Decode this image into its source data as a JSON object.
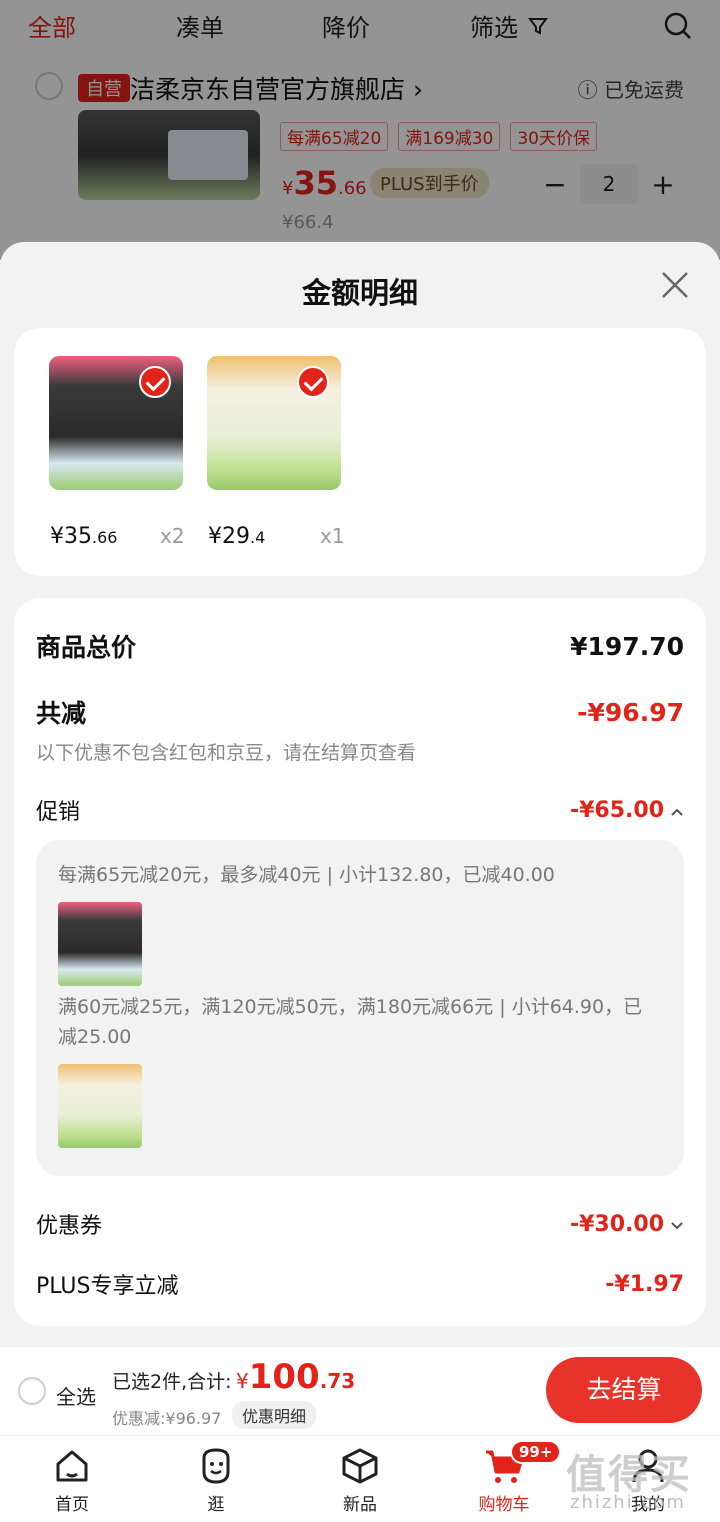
{
  "top_nav": {
    "tabs": [
      "全部",
      "凑单",
      "降价",
      "筛选"
    ]
  },
  "store": {
    "badge": "自营",
    "name": "洁柔京东自营官方旗舰店",
    "arrow": "›",
    "shipping": "ⓘ 已免运费"
  },
  "bg_product": {
    "tags": [
      "每满65减20",
      "满169减30",
      "30天价保"
    ],
    "price_symbol": "¥",
    "price_int": "35",
    "price_dec": ".66",
    "plus_label": "PLUS到手价",
    "qty": "2",
    "minus": "−",
    "plus": "+",
    "original_price": "¥66.4"
  },
  "sheet": {
    "title": "金额明细",
    "items": [
      {
        "price_int": "¥35",
        "price_dec": ".66",
        "qty": "x2"
      },
      {
        "price_int": "¥29",
        "price_dec": ".4",
        "qty": "x1"
      }
    ],
    "total_label": "商品总价",
    "total_value": "¥197.70",
    "reduce_label": "共减",
    "reduce_value": "-¥96.97",
    "reduce_note": "以下优惠不包含红包和京豆，请在结算页查看",
    "promo_label": "促销",
    "promo_value": "-¥65.00",
    "promo_line1": "每满65元减20元，最多减40元 | 小计132.80，已减40.00",
    "promo_line2": "满60元减25元，满120元减50元，满180元减66元 | 小计64.90，已减25.00",
    "coupon_label": "优惠券",
    "coupon_value": "-¥30.00",
    "plus_label": "PLUS专享立减",
    "plus_value": "-¥1.97"
  },
  "bottom_bar": {
    "select_all": "全选",
    "summary": "已选2件,合计:",
    "price_symbol": "¥",
    "price_int": "100",
    "price_dec": ".73",
    "saved": "优惠减:¥96.97",
    "detail_button": "优惠明细",
    "checkout": "去结算"
  },
  "tab_bar": {
    "tabs": [
      "首页",
      "逛",
      "新品",
      "购物车",
      "我的"
    ],
    "cart_badge": "99+"
  },
  "watermark": {
    "text": "值得买",
    "sub": "zhizhi.com"
  },
  "colors": {
    "accent": "#e2231a",
    "sheet_bg": "#f2f2f2"
  }
}
